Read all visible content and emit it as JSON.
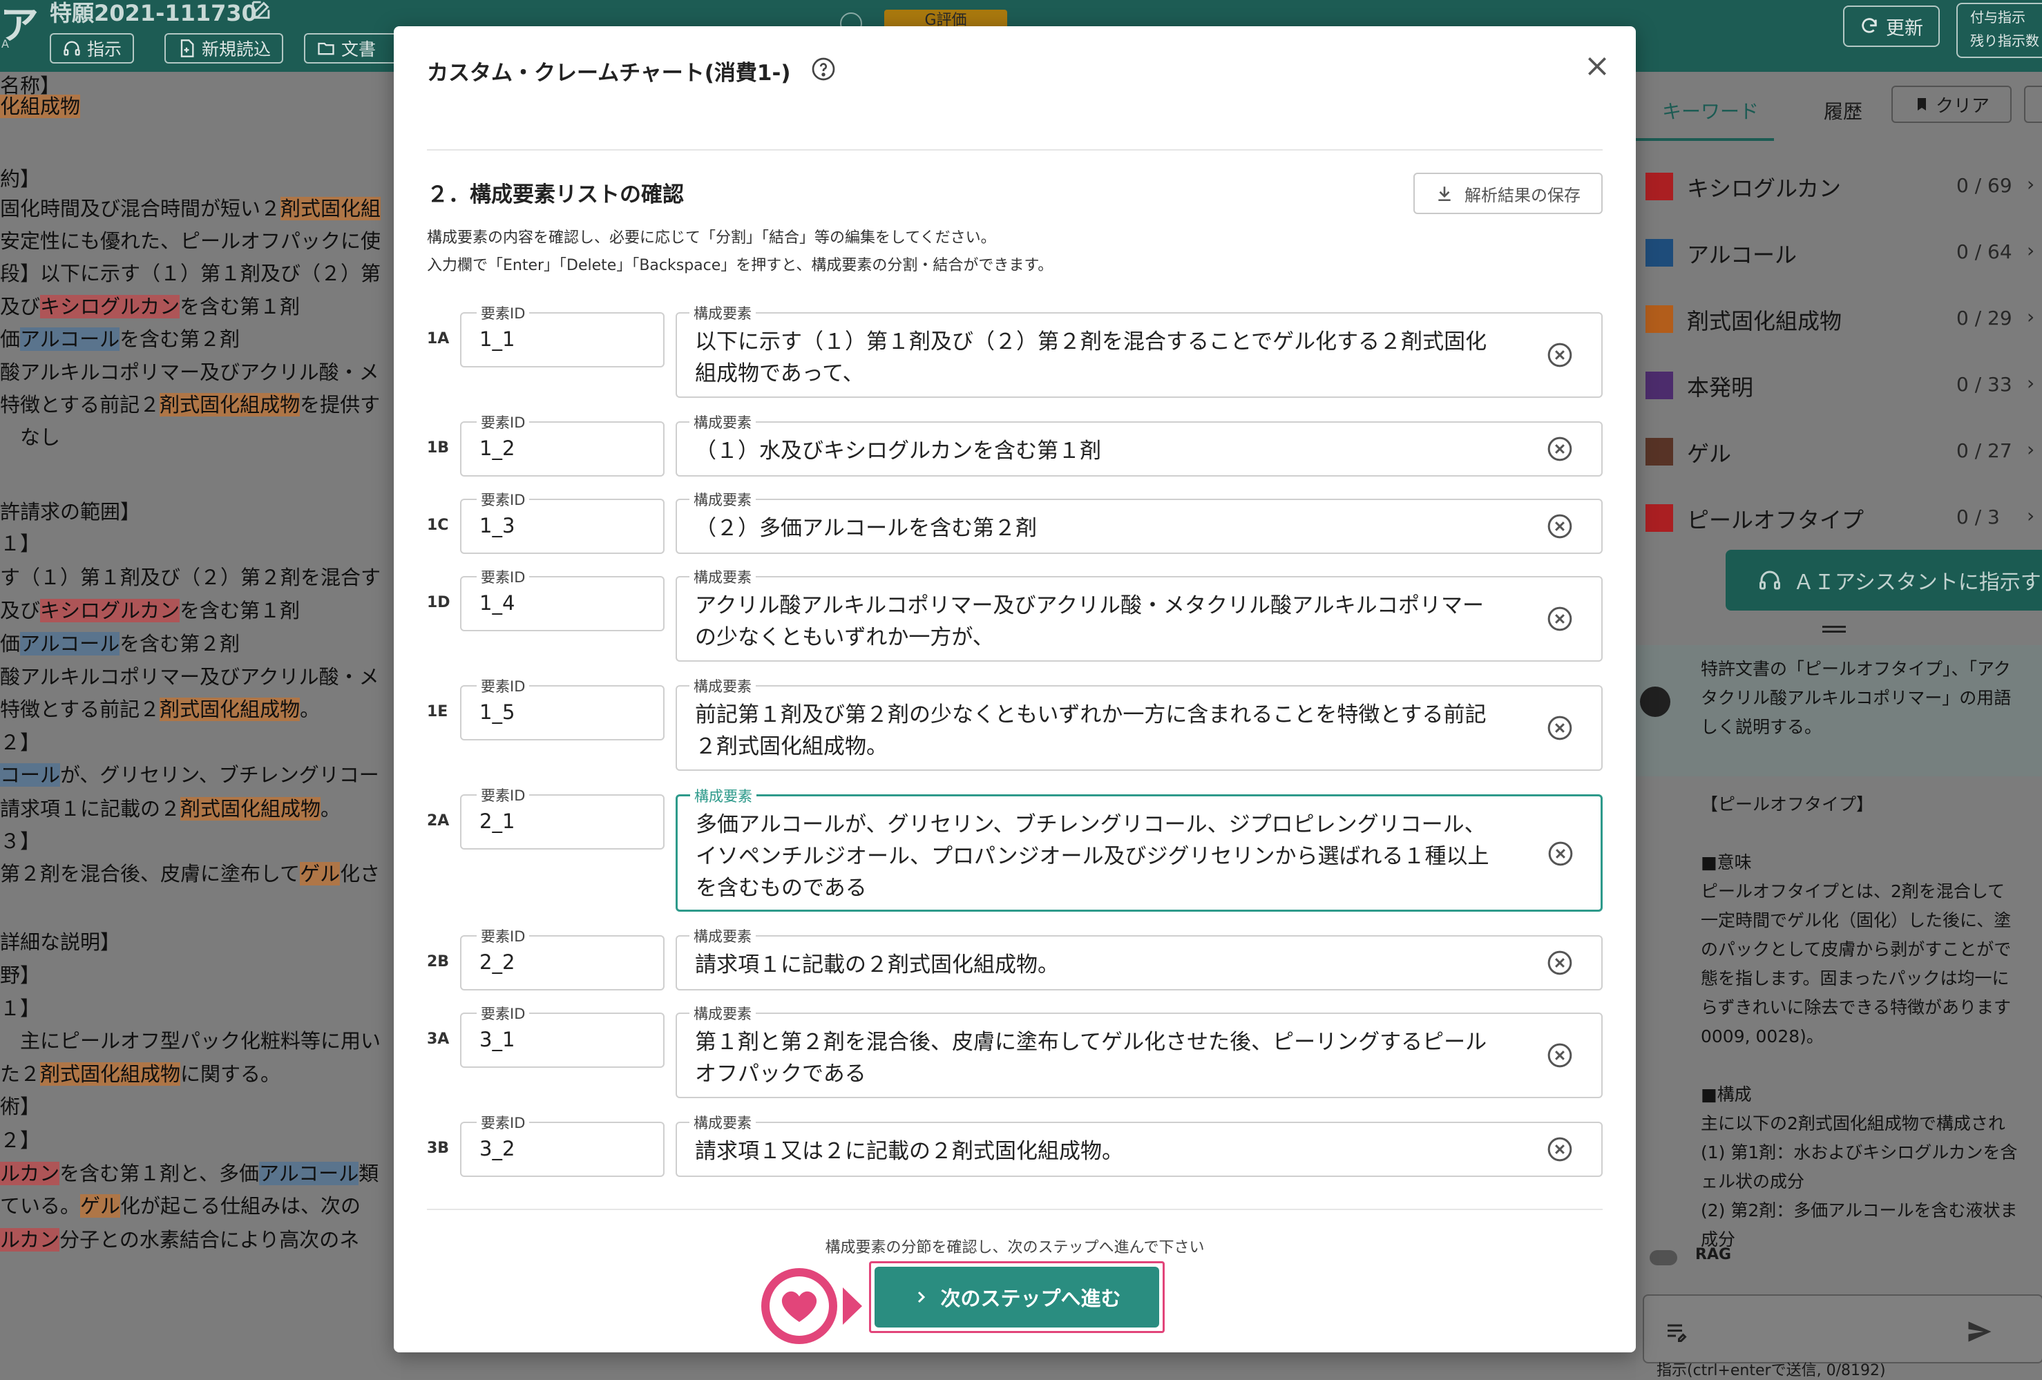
{
  "topbar": {
    "logo_char": "ア",
    "logo_sub": "A",
    "doc_title": "特願2021-111730",
    "buttons": [
      "指示",
      "新規読込",
      "文書"
    ],
    "grade_badge": "G評価",
    "refresh_label": "更新",
    "grant_lines": [
      "付与指示",
      "残り指示数"
    ]
  },
  "left_doc": {
    "lines": [
      {
        "parts": [
          {
            "t": "名称】"
          }
        ]
      },
      {
        "parts": [
          {
            "t": "化組成物",
            "hl": "o"
          }
        ]
      },
      {
        "parts": [
          {
            "t": ""
          }
        ]
      },
      {
        "parts": [
          {
            "t": "約】"
          }
        ]
      },
      {
        "parts": [
          {
            "t": "固化時間及び混合時間が短い２"
          },
          {
            "t": "剤式固化組",
            "hl": "o"
          }
        ]
      },
      {
        "parts": [
          {
            "t": "安定性にも優れた、ピールオフパックに使"
          }
        ]
      },
      {
        "parts": [
          {
            "t": "段】以下に示す（１）第１剤及び（２）第"
          }
        ]
      },
      {
        "parts": [
          {
            "t": "及び"
          },
          {
            "t": "キシログルカン",
            "hl": "r"
          },
          {
            "t": "を含む第１剤"
          }
        ]
      },
      {
        "parts": [
          {
            "t": "価"
          },
          {
            "t": "アルコール",
            "hl": "b"
          },
          {
            "t": "を含む第２剤"
          }
        ]
      },
      {
        "parts": [
          {
            "t": "酸アルキルコポリマー及びアクリル酸・メ"
          }
        ]
      },
      {
        "parts": [
          {
            "t": "特徴とする前記２"
          },
          {
            "t": "剤式固化組成物",
            "hl": "o"
          },
          {
            "t": "を提供す"
          }
        ]
      },
      {
        "parts": [
          {
            "t": "　なし"
          }
        ]
      },
      {
        "parts": [
          {
            "t": ""
          }
        ]
      },
      {
        "parts": [
          {
            "t": "許請求の範囲】"
          }
        ]
      },
      {
        "parts": [
          {
            "t": "１】"
          }
        ]
      },
      {
        "parts": [
          {
            "t": "す（１）第１剤及び（２）第２剤を混合す"
          }
        ]
      },
      {
        "parts": [
          {
            "t": "及び"
          },
          {
            "t": "キシログルカン",
            "hl": "r"
          },
          {
            "t": "を含む第１剤"
          }
        ]
      },
      {
        "parts": [
          {
            "t": "価"
          },
          {
            "t": "アルコール",
            "hl": "b"
          },
          {
            "t": "を含む第２剤"
          }
        ]
      },
      {
        "parts": [
          {
            "t": "酸アルキルコポリマー及びアクリル酸・メ"
          }
        ]
      },
      {
        "parts": [
          {
            "t": "特徴とする前記２"
          },
          {
            "t": "剤式固化組成物",
            "hl": "o"
          },
          {
            "t": "。"
          }
        ]
      },
      {
        "parts": [
          {
            "t": "２】"
          }
        ]
      },
      {
        "parts": [
          {
            "t": "コール",
            "hl": "b"
          },
          {
            "t": "が、グリセリン、ブチレングリコー"
          }
        ]
      },
      {
        "parts": [
          {
            "t": "請求項１に記載の２"
          },
          {
            "t": "剤式固化組成物",
            "hl": "o"
          },
          {
            "t": "。"
          }
        ]
      },
      {
        "parts": [
          {
            "t": "３】"
          }
        ]
      },
      {
        "parts": [
          {
            "t": "第２剤を混合後、皮膚に塗布して"
          },
          {
            "t": "ゲル",
            "hl": "o"
          },
          {
            "t": "化さ"
          }
        ]
      },
      {
        "parts": [
          {
            "t": ""
          }
        ]
      },
      {
        "parts": [
          {
            "t": "詳細な説明】"
          }
        ]
      },
      {
        "parts": [
          {
            "t": "野】"
          }
        ]
      },
      {
        "parts": [
          {
            "t": "１】"
          }
        ]
      },
      {
        "parts": [
          {
            "t": "　主にピールオフ型パック化粧料等に用い"
          }
        ]
      },
      {
        "parts": [
          {
            "t": "た２"
          },
          {
            "t": "剤式固化組成物",
            "hl": "o"
          },
          {
            "t": "に関する。"
          }
        ]
      },
      {
        "parts": [
          {
            "t": "術】"
          }
        ]
      },
      {
        "parts": [
          {
            "t": "２】"
          }
        ]
      },
      {
        "parts": [
          {
            "t": "ルカン",
            "hl": "r"
          },
          {
            "t": "を含む第１剤と、多価"
          },
          {
            "t": "アルコール",
            "hl": "b"
          },
          {
            "t": "類"
          }
        ]
      },
      {
        "parts": [
          {
            "t": "ている。"
          },
          {
            "t": "ゲル",
            "hl": "o"
          },
          {
            "t": "化が起こる仕組みは、次の"
          }
        ]
      },
      {
        "parts": [
          {
            "t": "ルカン",
            "hl": "r"
          },
          {
            "t": "分子との水素結合により高次のネ"
          }
        ]
      }
    ]
  },
  "right_panel": {
    "tabs": [
      "キーワード",
      "履歴"
    ],
    "clear_label": "クリア",
    "keywords": [
      {
        "name": "キシログルカン",
        "count": "0 / 69",
        "color": "#b02024"
      },
      {
        "name": "アルコール",
        "count": "0 / 64",
        "color": "#1f4f7e"
      },
      {
        "name": "剤式固化組成物",
        "count": "0 / 29",
        "color": "#b8601c"
      },
      {
        "name": "本発明",
        "count": "0 / 33",
        "color": "#4f2e70"
      },
      {
        "name": "ゲル",
        "count": "0 / 27",
        "color": "#5a3528"
      },
      {
        "name": "ピールオフタイプ",
        "count": "0 / 3",
        "color": "#b02024"
      }
    ],
    "ai_button": "ＡＩアシスタントに指示す",
    "ai_bubble_lines": [
      "特許文書の「ピールオフタイプ」、「アク",
      "タクリル酸アルキルコポリマー」の用語",
      "しく説明する。"
    ],
    "response_lines": [
      "【ピールオフタイプ】",
      "",
      "■意味",
      "ピールオフタイプとは、2剤を混合して",
      "一定時間でゲル化（固化）した後に、塗",
      "のパックとして皮膚から剥がすことがで",
      "態を指します。固まったパックは均一に",
      "らずきれいに除去できる特徴があります",
      "0009, 0028)。",
      "",
      "■構成",
      "主に以下の2剤式固化組成物で構成され",
      "(1) 第1剤：水およびキシログルカンを含",
      "ェル状の成分",
      "(2) 第2剤：多価アルコールを含む液状ま",
      "成分"
    ],
    "rag_label": "RAG",
    "input_hint": "指示(ctrl+enterで送信, 0/8192)"
  },
  "modal": {
    "title": "カスタム・クレームチャート(消費1-)",
    "step_title": "２．構成要素リストの確認",
    "save_label": "解析結果の保存",
    "desc_lines": [
      "構成要素の内容を確認し、必要に応じて「分割」「結合」等の編集をしてください。",
      "入力欄で「Enter」「Delete」「Backspace」を押すと、構成要素の分割・結合ができます。"
    ],
    "id_label": "要素ID",
    "element_label": "構成要素",
    "rows": [
      {
        "label": "1A",
        "id": "1_1",
        "text": "以下に示す（１）第１剤及び（２）第２剤を混合することでゲル化する２剤式固化\n組成物であって、"
      },
      {
        "label": "1B",
        "id": "1_2",
        "text": "（１）水及びキシログルカンを含む第１剤"
      },
      {
        "label": "1C",
        "id": "1_3",
        "text": "（２）多価アルコールを含む第２剤"
      },
      {
        "label": "1D",
        "id": "1_4",
        "text": "アクリル酸アルキルコポリマー及びアクリル酸・メタクリル酸アルキルコポリマー\nの少なくともいずれか一方が、"
      },
      {
        "label": "1E",
        "id": "1_5",
        "text": "前記第１剤及び第２剤の少なくともいずれか一方に含まれることを特徴とする前記\n２剤式固化組成物。"
      },
      {
        "label": "2A",
        "id": "2_1",
        "text": "多価アルコールが、グリセリン、ブチレングリコール、ジプロピレングリコール、\nイソペンチルジオール、プロパンジオール及びジグリセリンから選ばれる１種以上\nを含むものである"
      },
      {
        "label": "2B",
        "id": "2_2",
        "text": "請求項１に記載の２剤式固化組成物。"
      },
      {
        "label": "3A",
        "id": "3_1",
        "text": "第１剤と第２剤を混合後、皮膚に塗布してゲル化させた後、ピーリングするピール\nオフパックである"
      },
      {
        "label": "3B",
        "id": "3_2",
        "text": "請求項１又は２に記載の２剤式固化組成物。"
      }
    ],
    "bottom_hint": "構成要素の分節を確認し、次のステップへ進んで下さい",
    "next_label": "次のステップへ進む"
  }
}
